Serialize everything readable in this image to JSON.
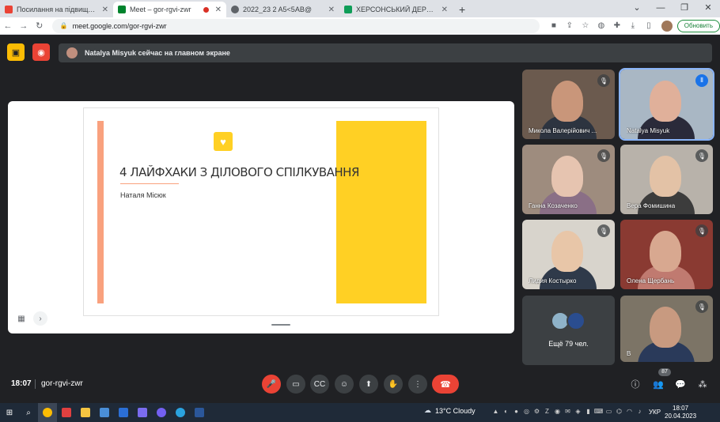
{
  "browser": {
    "tabs": [
      {
        "title": "Посилання на підвищення квал",
        "favicon_color": "#ea4335",
        "icon": "gmail-icon"
      },
      {
        "title": "Meet – gor-rgvi-zwr",
        "favicon_color": "#00832d",
        "icon": "meet-icon",
        "active": true
      },
      {
        "title": "2022_23 2 A5<5AB@",
        "favicon_color": "#5f6368",
        "icon": "globe-icon"
      },
      {
        "title": "ХЕРСОНСЬКИЙ ДЕРЖАВНИЙ А",
        "favicon_color": "#0f9d58",
        "icon": "sheets-icon"
      }
    ],
    "new_tab": "+",
    "url": "meet.google.com/gor-rgvi-zwr",
    "update_label": "Обновить"
  },
  "meet": {
    "banner_text": "Natalya Misyuk сейчас на главном экране",
    "presentation": {
      "title": "4 ЛАЙФХАКИ З ДІЛОВОГО СПІЛКУВАННЯ",
      "subtitle": "Наталя Місюк"
    },
    "participants": [
      {
        "name": "Микола Валерійович ...",
        "muted": true,
        "bg": "#6b5a4e",
        "face": "#c9967a",
        "body": "#2d3440"
      },
      {
        "name": "Natalya Misyuk",
        "muted": false,
        "speaking": true,
        "bg": "#a9b7c4",
        "face": "#e0b09a",
        "body": "#2a2a3a"
      },
      {
        "name": "Ганна Козаченко",
        "muted": true,
        "bg": "#9e8c7e",
        "face": "#e6c4b0",
        "body": "#8a6f86"
      },
      {
        "name": "Вера Фомишина",
        "muted": true,
        "bg": "#b8b2aa",
        "face": "#e3c2a6",
        "body": "#3c3c3c"
      },
      {
        "name": "Лидия Костырко",
        "muted": true,
        "bg": "#d8d4cc",
        "face": "#e8c6a8",
        "body": "#2f3a4a"
      },
      {
        "name": "Олена Щербань",
        "muted": true,
        "bg": "#8a3a32",
        "face": "#d8a890",
        "body": "#c07a70"
      },
      {
        "name": "Ещё 79 чел.",
        "more": true
      },
      {
        "name": "В",
        "muted": true,
        "bg": "#7c7466",
        "face": "#c89a80",
        "body": "#2a3a5a"
      }
    ],
    "time": "18:07",
    "meeting_code": "gor-rgvi-zwr",
    "participant_count": "87"
  },
  "taskbar": {
    "weather": "13°C  Cloudy",
    "lang": "УКР",
    "clock_time": "18:07",
    "clock_date": "20.04.2023"
  },
  "colors": {
    "accent_red": "#ea4335",
    "slide_orange": "#f9a17e",
    "slide_yellow": "#ffd024"
  }
}
